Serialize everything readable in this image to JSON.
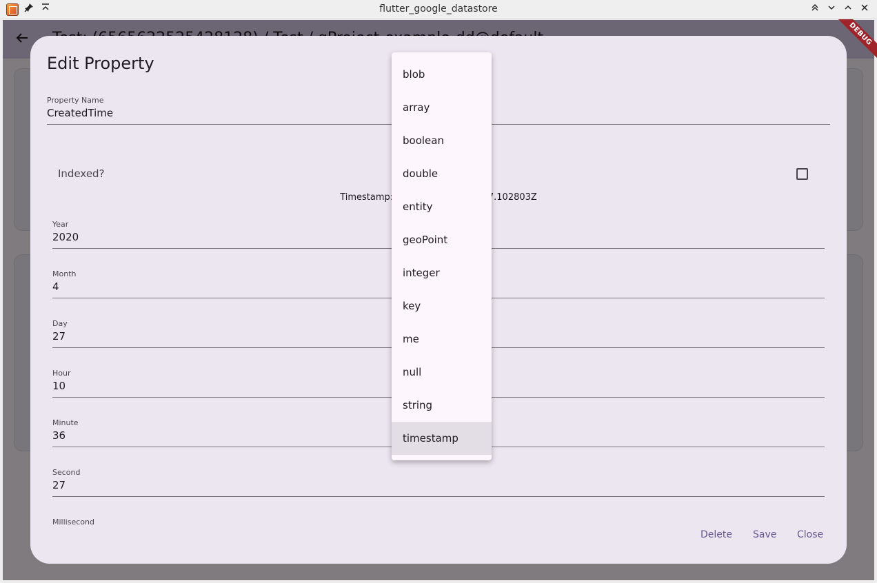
{
  "window": {
    "title": "flutter_google_datastore"
  },
  "appbar": {
    "title": "Test: (6565622525428128) / Test / gProject-example-dd@default"
  },
  "debug_banner": "DEBUG",
  "dialog": {
    "title": "Edit Property",
    "property_name": {
      "label": "Property Name",
      "value": "CreatedTime"
    },
    "indexed_label": "Indexed?",
    "indexed_checked": false,
    "timestamp_text": "Timestamp: 2020-04-27T10:36:27.102803Z",
    "fields": [
      {
        "label": "Year",
        "value": "2020"
      },
      {
        "label": "Month",
        "value": "4"
      },
      {
        "label": "Day",
        "value": "27"
      },
      {
        "label": "Hour",
        "value": "10"
      },
      {
        "label": "Minute",
        "value": "36"
      },
      {
        "label": "Second",
        "value": "27"
      },
      {
        "label": "Millisecond",
        "value": ""
      }
    ],
    "buttons": {
      "delete": "Delete",
      "save": "Save",
      "close": "Close"
    }
  },
  "type_menu": {
    "items": [
      "blob",
      "array",
      "boolean",
      "double",
      "entity",
      "geoPoint",
      "integer",
      "key",
      "me",
      "null",
      "string",
      "timestamp"
    ],
    "selected": "timestamp"
  }
}
